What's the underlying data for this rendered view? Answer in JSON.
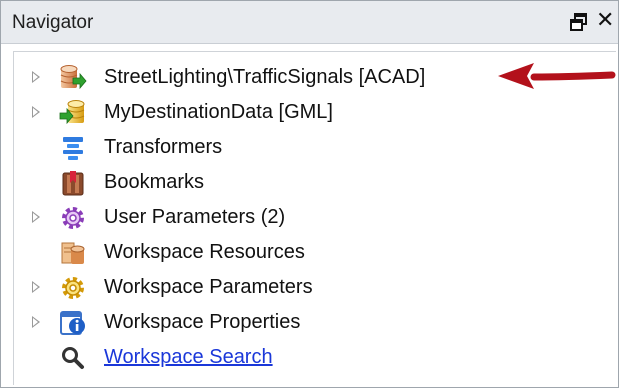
{
  "window": {
    "title": "Navigator",
    "float_icon": "float-window-icon",
    "close_glyph": "✕"
  },
  "tree": {
    "items": [
      {
        "label": "StreetLighting\\TrafficSignals [ACAD]",
        "icon": "source-dataset-icon",
        "expandable": true
      },
      {
        "label": "MyDestinationData [GML]",
        "icon": "destination-dataset-icon",
        "expandable": true
      },
      {
        "label": "Transformers",
        "icon": "transformers-icon",
        "expandable": false
      },
      {
        "label": "Bookmarks",
        "icon": "bookmarks-icon",
        "expandable": false
      },
      {
        "label": "User Parameters (2)",
        "icon": "user-parameters-gear-icon",
        "expandable": true
      },
      {
        "label": "Workspace Resources",
        "icon": "workspace-resources-icon",
        "expandable": false
      },
      {
        "label": "Workspace Parameters",
        "icon": "workspace-parameters-gear-icon",
        "expandable": true
      },
      {
        "label": "Workspace Properties",
        "icon": "workspace-properties-info-icon",
        "expandable": true
      },
      {
        "label": "Workspace Search",
        "icon": "search-icon",
        "expandable": false,
        "is_link": true
      }
    ]
  },
  "colors": {
    "link": "#1a37d9",
    "arrow": "#b3111b",
    "titlebar": "#e8ebef"
  }
}
